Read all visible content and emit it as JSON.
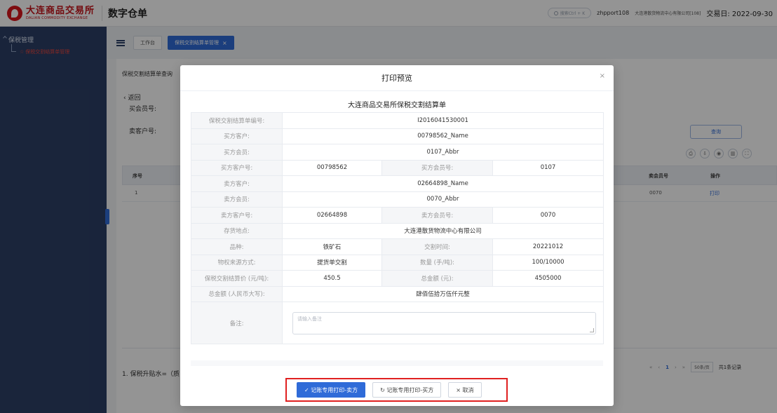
{
  "header": {
    "logo_cn": "大连商品交易所",
    "logo_en": "DALIAN COMMODITY EXCHANGE",
    "app_title": "数字仓单",
    "search_placeholder": "搜索Ctrl + K",
    "user": "zhpport108",
    "org": "大连港散货物流中心有限公司[108]",
    "trade_date": "交易日: 2022-09-30"
  },
  "sidebar": {
    "group": "保税管理",
    "item": "保税交割结算单管理"
  },
  "tabs": {
    "workbench": "工作台",
    "active": "保税交割结算单管理"
  },
  "page": {
    "crumb": "保税交割结算单查询",
    "back": "返回",
    "label_member": "买会员号:",
    "label_customer": "卖客户号:",
    "query_button": "查询",
    "table_headers": {
      "seq": "序号",
      "seller_member": "卖会员号",
      "action": "操作"
    },
    "row": {
      "seq": "1",
      "seller_member": "0070",
      "action": "打印"
    },
    "pager_current": "1",
    "pager_size": "50条/页",
    "pager_total": "共1条记录",
    "note": "1. 保税升贴水=（质"
  },
  "dialog": {
    "title": "打印预览",
    "doc_title": "大连商品交易所保税交割结算单",
    "fields": {
      "settle_no_label": "保税交割结算单编号:",
      "settle_no": "I2016041530001",
      "buyer_customer_label": "买方客户:",
      "buyer_customer": "00798562_Name",
      "buyer_member_label": "买方会员:",
      "buyer_member": "0107_Abbr",
      "buyer_customer_no_label": "买方客户号:",
      "buyer_customer_no": "00798562",
      "buyer_member_no_label": "买方会员号:",
      "buyer_member_no": "0107",
      "seller_customer_label": "卖方客户:",
      "seller_customer": "02664898_Name",
      "seller_member_label": "卖方会员:",
      "seller_member": "0070_Abbr",
      "seller_customer_no_label": "卖方客户号:",
      "seller_customer_no": "02664898",
      "seller_member_no_label": "卖方会员号:",
      "seller_member_no": "0070",
      "storage_label": "存货地点:",
      "storage": "大连港散货物流中心有限公司",
      "variety_label": "品种:",
      "variety": "铁矿石",
      "delivery_time_label": "交割时间:",
      "delivery_time": "20221012",
      "source_label": "物权来源方式:",
      "source": "提货单交割",
      "quantity_label": "数量 (手/吨):",
      "quantity": "100/10000",
      "price_label": "保税交割结算价 (元/吨):",
      "price": "450.5",
      "amount_label": "总金额 (元):",
      "amount": "4505000",
      "amount_cn_label": "总金额 (人民币大写):",
      "amount_cn": "肆佰伍拾万伍仟元整",
      "remark_label": "备注:",
      "remark_placeholder": "请输入备注"
    },
    "buttons": {
      "print_seller": "记账专用打印-卖方",
      "print_buyer": "记账专用打印-买方",
      "cancel": "取消"
    }
  }
}
